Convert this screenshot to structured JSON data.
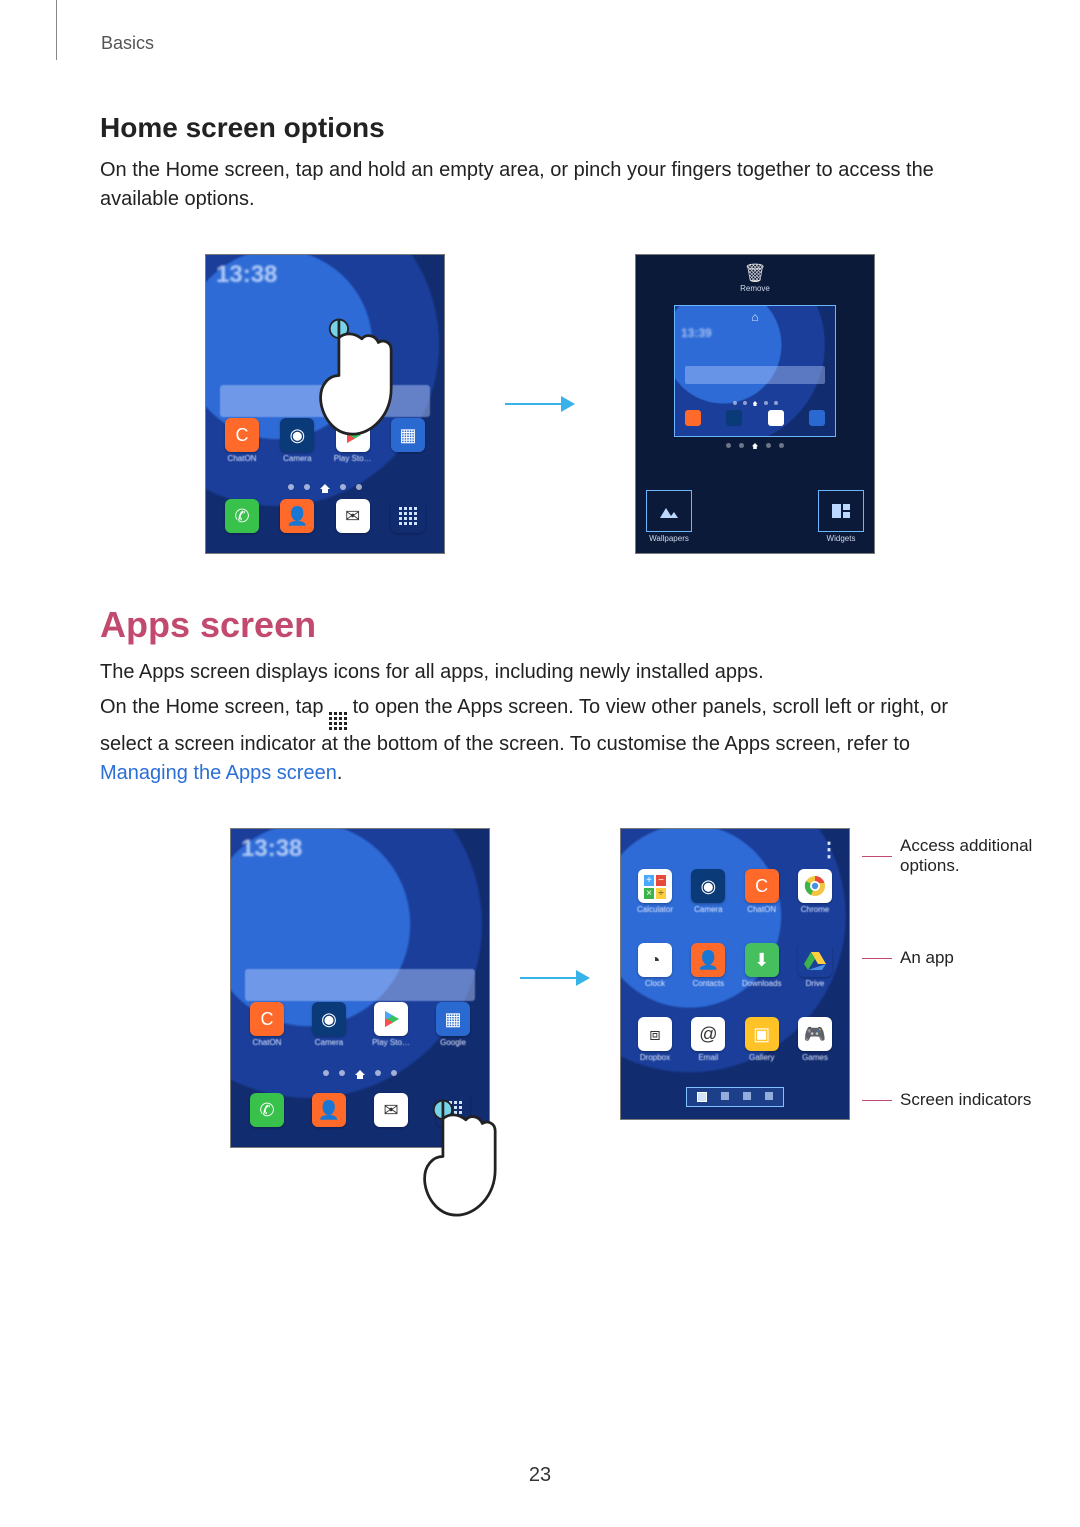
{
  "breadcrumb": "Basics",
  "page_number": "23",
  "section1": {
    "title": "Home screen options",
    "body": "On the Home screen, tap and hold an empty area, or pinch your fingers together to access the available options."
  },
  "section2": {
    "title": "Apps screen",
    "p1": "The Apps screen displays icons for all apps, including newly installed apps.",
    "p2_a": "On the Home screen, tap ",
    "p2_b": " to open the Apps screen. To view other panels, scroll left or right, or select a screen indicator at the bottom of the screen. To customise the Apps screen, refer to ",
    "link": "Managing the Apps screen",
    "p2_c": "."
  },
  "home_phone": {
    "clock": "13:38",
    "row1": [
      "ChatON",
      "Camera",
      "Play Sto…",
      ""
    ],
    "row1_icons": [
      "chaton",
      "camera",
      "play",
      "folder"
    ],
    "row0": [
      "",
      "",
      "",
      ""
    ],
    "row0_icons": [
      "phone",
      "contacts",
      "mail",
      "apps"
    ]
  },
  "edit_phone": {
    "top_label": "Remove",
    "mini_clock": "13:39",
    "mini_row": [
      "chaton",
      "camera",
      "play",
      "folder"
    ],
    "bottom_left": "Wallpapers",
    "bottom_right": "Widgets"
  },
  "apps_phone_left": {
    "clock": "13:38",
    "row1": [
      "ChatON",
      "Camera",
      "Play Sto…",
      "Google"
    ],
    "row1_icons": [
      "chaton",
      "camera",
      "play",
      "folder-g"
    ],
    "row0_icons": [
      "phone",
      "contacts",
      "mail",
      "apps"
    ]
  },
  "apps_phone_right": {
    "rows": [
      [
        {
          "name": "Calculator",
          "icon": "calculator",
          "color": "#ffffff"
        },
        {
          "name": "Camera",
          "icon": "camera",
          "color": "#0a3a78"
        },
        {
          "name": "ChatON",
          "icon": "chaton",
          "color": "#ff6a2b"
        },
        {
          "name": "Chrome",
          "icon": "chrome",
          "color": "#ffffff"
        }
      ],
      [
        {
          "name": "Clock",
          "icon": "clock",
          "color": "#ffffff"
        },
        {
          "name": "Contacts",
          "icon": "contacts",
          "color": "#ff6a2b"
        },
        {
          "name": "Downloads",
          "icon": "downloads",
          "color": "#46c05f"
        },
        {
          "name": "Drive",
          "icon": "drive",
          "color": "#1f2937"
        }
      ],
      [
        {
          "name": "Dropbox",
          "icon": "dropbox",
          "color": "#ffffff"
        },
        {
          "name": "Email",
          "icon": "email",
          "color": "#ffffff"
        },
        {
          "name": "Gallery",
          "icon": "gallery",
          "color": "#ffc227"
        },
        {
          "name": "Games",
          "icon": "games",
          "color": "#ffffff"
        }
      ]
    ],
    "callouts": {
      "options": "Access additional options.",
      "app": "An app",
      "pager": "Screen indicators"
    }
  },
  "icons": {
    "chaton": {
      "bg": "#ff6a2b",
      "glyph": "C"
    },
    "camera": {
      "bg": "#0a3a78",
      "glyph": "◉"
    },
    "play": {
      "bg": "#ffffff",
      "glyph": "▶"
    },
    "folder": {
      "bg": "#2a6ad0",
      "glyph": "▦"
    },
    "folder-g": {
      "bg": "#2a6ad0",
      "glyph": "▦"
    },
    "phone": {
      "bg": "#39c24b",
      "glyph": "✆"
    },
    "contacts": {
      "bg": "#ff6a2b",
      "glyph": "👤"
    },
    "mail": {
      "bg": "#ffffff",
      "glyph": "✉"
    },
    "apps": {
      "bg": "transparent",
      "glyph": "⋮⋮"
    },
    "calculator": {
      "bg": "#ffffff",
      "glyph": "±"
    },
    "chrome": {
      "bg": "#ffffff",
      "glyph": "◯"
    },
    "clock": {
      "bg": "#ffffff",
      "glyph": "◔"
    },
    "downloads": {
      "bg": "#46c05f",
      "glyph": "⬇"
    },
    "drive": {
      "bg": "#1f2937",
      "glyph": "▲"
    },
    "dropbox": {
      "bg": "#ffffff",
      "glyph": "⧈"
    },
    "email": {
      "bg": "#ffffff",
      "glyph": "@"
    },
    "gallery": {
      "bg": "#ffc227",
      "glyph": "▣"
    },
    "games": {
      "bg": "#ffffff",
      "glyph": "🎮"
    },
    "trash": {
      "glyph": "🗑"
    },
    "home": {
      "glyph": "⌂"
    },
    "more": {
      "glyph": "⋮"
    }
  }
}
